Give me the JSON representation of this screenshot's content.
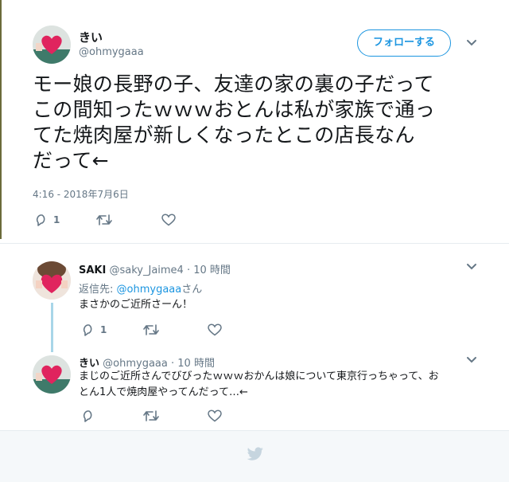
{
  "main_tweet": {
    "display_name": "きい",
    "handle": "@ohmygaaa",
    "follow_label": "フォローする",
    "text_lines": [
      "モー娘の長野の子、友達の家の裏の子だって",
      "この間知ったｗｗｗおとんは私が家族で通っ",
      "てた焼肉屋が新しくなったとこの店長なん",
      "だって←"
    ],
    "timestamp": "4:16 - 2018年7月6日",
    "reply_count": "1"
  },
  "replies": [
    {
      "display_name": "SAKI",
      "handle": "@saky_Jaime4",
      "separator": "·",
      "time": "10 時間",
      "reply_to_label": "返信先:",
      "reply_to_mention": "@ohmygaaa",
      "reply_to_suffix": "さん",
      "text": "まさかのご近所さーん！",
      "reply_count": "1"
    },
    {
      "display_name": "きい",
      "handle": "@ohmygaaa",
      "separator": "·",
      "time": "10 時間",
      "text_lines": [
        "まじのご近所さんでびびったｗｗｗおかんは娘について東京行っちゃって、お",
        "とん1人で焼肉屋やってんだって…←"
      ]
    }
  ],
  "icons": {
    "chevron": "chevron-down-icon",
    "reply": "reply-icon",
    "retweet": "retweet-icon",
    "like": "heart-icon",
    "logo": "twitter-bird-icon"
  },
  "colors": {
    "accent": "#1b95e0",
    "muted": "#657786",
    "text": "#14171a",
    "thread_line": "#a8d6e8",
    "footer_bg": "#f5f8fa",
    "avatar_heart": "#e0245e"
  }
}
